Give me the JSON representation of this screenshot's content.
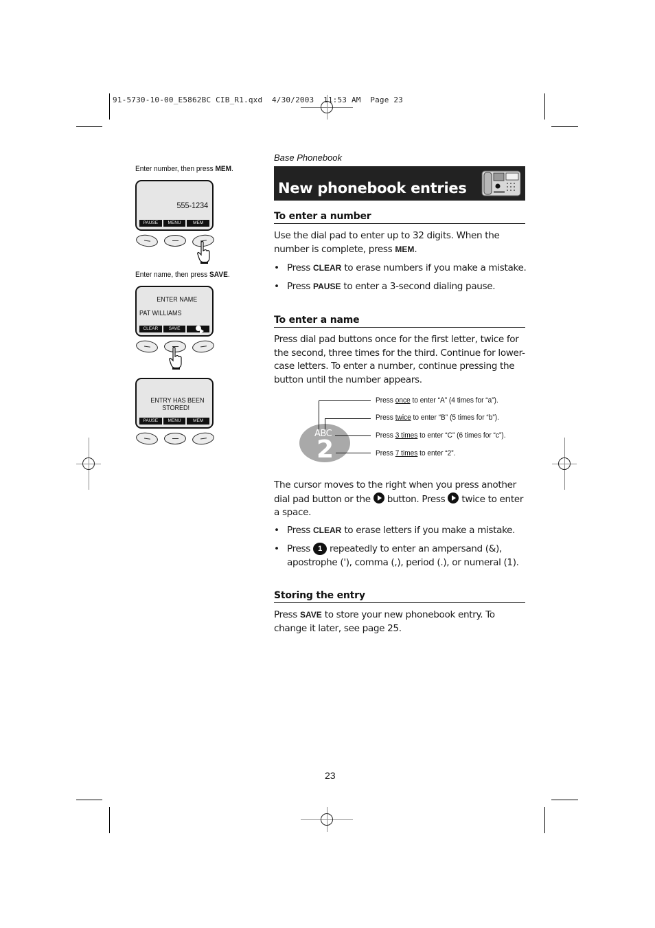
{
  "slug": "91-5730-10-00_E5862BC CIB_R1.qxd  4/30/2003  11:53 AM  Page 23",
  "left_column": {
    "steps": [
      {
        "caption_pre": "Enter number, then press ",
        "caption_key": "MEM",
        "caption_post": ".",
        "display_lines": [
          "555-1234"
        ],
        "softkeys": [
          "PAUSE",
          "MENU",
          "MEM"
        ],
        "pressed_button": 3
      },
      {
        "caption_pre": "Enter name, then press ",
        "caption_key": "SAVE",
        "caption_post": ".",
        "display_lines": [
          "ENTER NAME",
          "PAT WILLIAMS"
        ],
        "softkeys": [
          "CLEAR",
          "SAVE",
          "play-icon"
        ],
        "pressed_button": 2
      },
      {
        "display_lines": [
          "ENTRY HAS BEEN",
          "STORED!"
        ],
        "softkeys": [
          "PAUSE",
          "MENU",
          "MEM"
        ],
        "pressed_button": 0
      }
    ]
  },
  "header": {
    "section_label": "Base Phonebook",
    "title": "New phonebook entries",
    "icon": "base-phone-icon"
  },
  "sections": {
    "enter_number": {
      "heading": "To enter a number",
      "para_pre": "Use the dial pad to enter up to 32 digits. When the number is complete, press ",
      "para_key": "MEM",
      "para_post": ".",
      "bullets": [
        {
          "pre": "Press ",
          "key": "CLEAR",
          "post": " to erase numbers if you make a mistake."
        },
        {
          "pre": "Press ",
          "key": "PAUSE",
          "post": " to enter a 3-second dialing pause."
        }
      ]
    },
    "enter_name": {
      "heading": "To enter a name",
      "para": "Press dial pad buttons once for the first letter, twice for the second, three times for the third. Continue for lower-case letters. To enter a number, continue pressing the button until the number appears.",
      "diagram": {
        "key_letters": "ABC",
        "key_number": "2",
        "callouts": [
          {
            "pre": "Press ",
            "emph": "once",
            "post": " to enter “A” (4 times for “a”)."
          },
          {
            "pre": "Press ",
            "emph": "twice",
            "post": " to enter “B” (5 times for “b”)."
          },
          {
            "pre": "Press ",
            "emph": "3 times",
            "post": " to enter “C” (6 times for “c”)."
          },
          {
            "pre": "Press ",
            "emph": "7 times",
            "post": " to enter “2”."
          }
        ]
      },
      "cursor_para": {
        "part1": "The cursor moves to the right when you press another dial pad button or the ",
        "part2": " button. Press ",
        "part3": " twice to enter a space."
      },
      "bullets": [
        {
          "pre": "Press ",
          "key": "CLEAR",
          "post": " to erase letters if you make a mistake."
        },
        {
          "pre": "Press ",
          "icon_label": "1",
          "post": " repeatedly to enter an ampersand (&), apostrophe ('), comma (,), period (.), or numeral (1)."
        }
      ]
    },
    "storing": {
      "heading": "Storing the entry",
      "para_pre": "Press ",
      "para_key": "SAVE",
      "para_post": " to store your new phonebook entry. To change it later, see page 25."
    }
  },
  "page_number": "23",
  "bullet_char": "•"
}
